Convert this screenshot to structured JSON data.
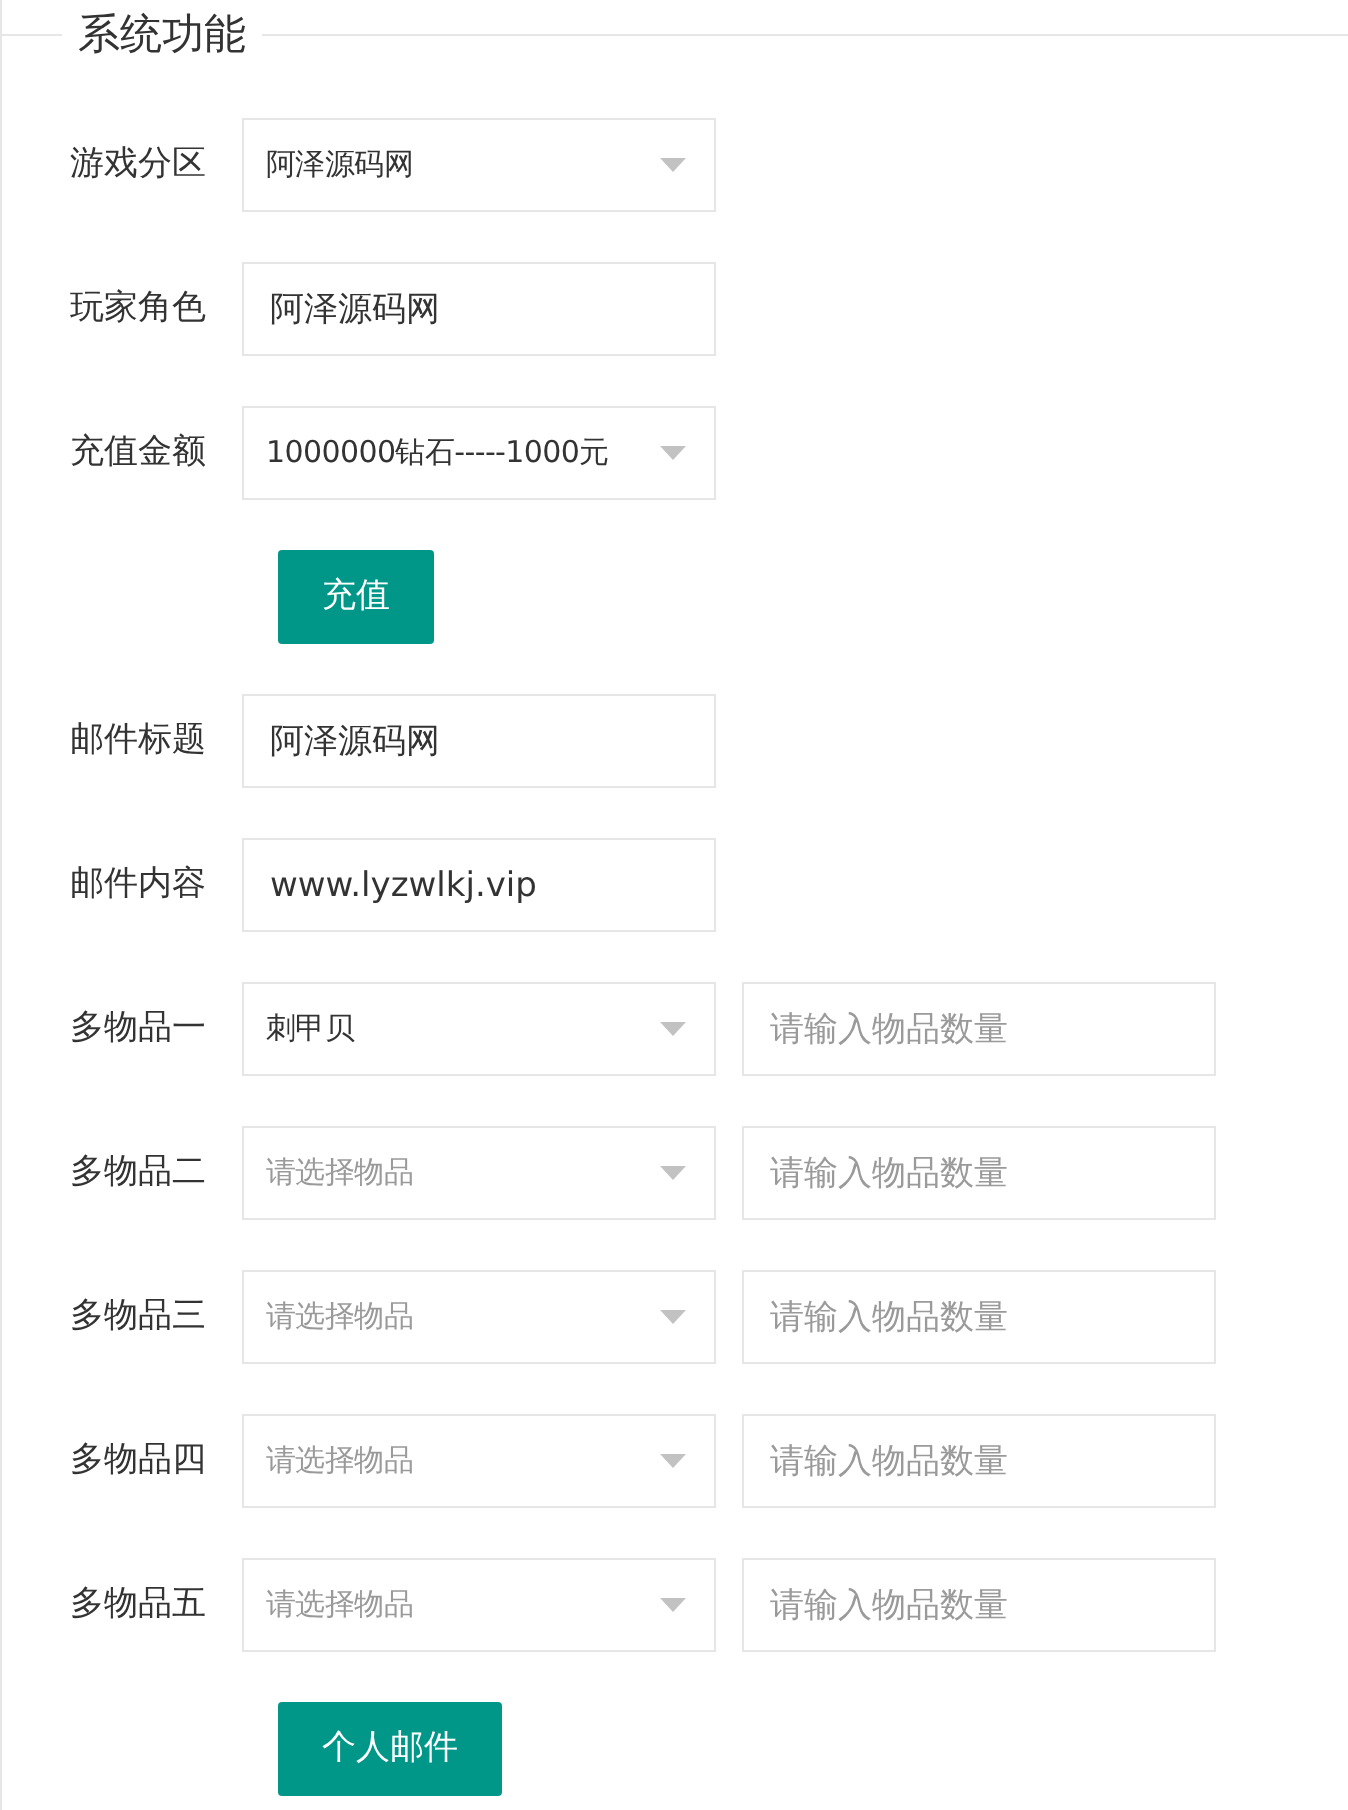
{
  "legend": "系统功能",
  "rows": [
    {
      "kind": "select",
      "label": "游戏分区",
      "value": "阿泽源码网"
    },
    {
      "kind": "input",
      "label": "玩家角色",
      "value": "阿泽源码网"
    },
    {
      "kind": "select",
      "label": "充值金额",
      "value": "1000000钻石-----1000元"
    },
    {
      "kind": "button",
      "text": "充值"
    },
    {
      "kind": "input",
      "label": "邮件标题",
      "value": "阿泽源码网"
    },
    {
      "kind": "input",
      "label": "邮件内容",
      "value": "www.lyzwlkj.vip"
    },
    {
      "kind": "pair",
      "label": "多物品一",
      "item": {
        "value": "刺甲贝"
      },
      "quantity": {
        "placeholder": "请输入物品数量"
      }
    },
    {
      "kind": "pair",
      "label": "多物品二",
      "item": {
        "placeholder": "请选择物品"
      },
      "quantity": {
        "placeholder": "请输入物品数量"
      }
    },
    {
      "kind": "pair",
      "label": "多物品三",
      "item": {
        "placeholder": "请选择物品"
      },
      "quantity": {
        "placeholder": "请输入物品数量"
      }
    },
    {
      "kind": "pair",
      "label": "多物品四",
      "item": {
        "placeholder": "请选择物品"
      },
      "quantity": {
        "placeholder": "请输入物品数量"
      }
    },
    {
      "kind": "pair",
      "label": "多物品五",
      "item": {
        "placeholder": "请选择物品"
      },
      "quantity": {
        "placeholder": "请输入物品数量"
      }
    },
    {
      "kind": "button",
      "text": "个人邮件"
    }
  ]
}
